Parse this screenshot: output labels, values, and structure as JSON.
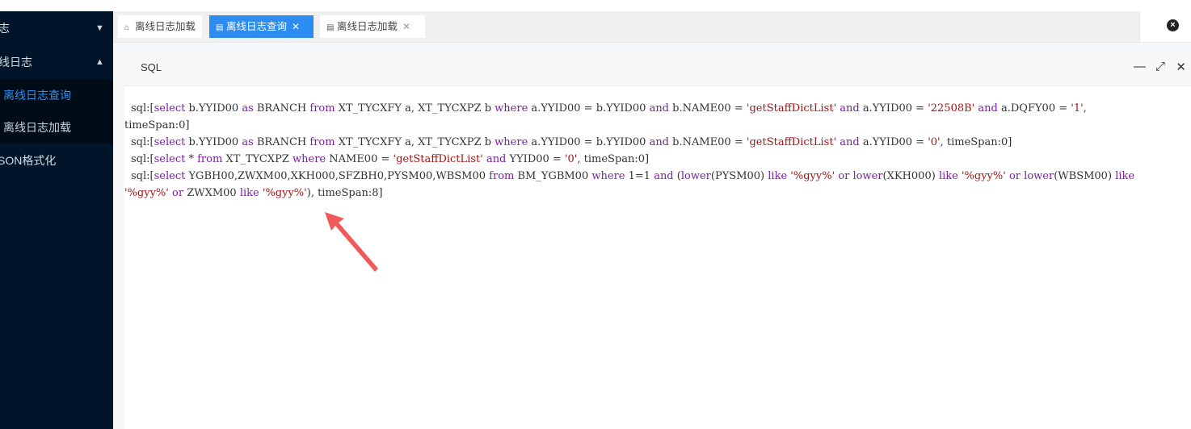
{
  "sidebar": {
    "group1": "志",
    "group2": "线日志",
    "items": [
      "离线日志查询",
      "离线日志加载"
    ],
    "group3": "SON格式化"
  },
  "tabs": [
    {
      "icon": "home-icon",
      "label": "离线日志加载",
      "closable": false
    },
    {
      "icon": "file-icon",
      "label": "离线日志查询",
      "closable": true,
      "active": true
    },
    {
      "icon": "file-icon",
      "label": "离线日志加载",
      "closable": true
    }
  ],
  "panel": {
    "title": "SQL"
  },
  "sql_lines": [
    [
      [
        "p",
        "sql:["
      ],
      [
        "k",
        "select"
      ],
      [
        "p",
        " b.YYID00 "
      ],
      [
        "k",
        "as"
      ],
      [
        "p",
        " BRANCH "
      ],
      [
        "k",
        "from"
      ],
      [
        "p",
        " XT_TYCXFY a, XT_TYCXPZ b "
      ],
      [
        "k",
        "where"
      ],
      [
        "p",
        " a.YYID00 = b.YYID00 "
      ],
      [
        "k",
        "and"
      ],
      [
        "p",
        " b.NAME00 = "
      ],
      [
        "s",
        "'getStaffDictList'"
      ],
      [
        "p",
        " "
      ],
      [
        "k",
        "and"
      ],
      [
        "p",
        " a.YYID00 = "
      ],
      [
        "s",
        "'22508B'"
      ],
      [
        "p",
        " "
      ],
      [
        "k",
        "and"
      ],
      [
        "p",
        " a.DQFY00 = "
      ],
      [
        "s",
        "'1'"
      ],
      [
        "p",
        ","
      ]
    ],
    [
      [
        "p",
        "timeSpan:0]"
      ]
    ],
    [
      [
        "p",
        "sql:["
      ],
      [
        "k",
        "select"
      ],
      [
        "p",
        " b.YYID00 "
      ],
      [
        "k",
        "as"
      ],
      [
        "p",
        " BRANCH "
      ],
      [
        "k",
        "from"
      ],
      [
        "p",
        " XT_TYCXFY a, XT_TYCXPZ b "
      ],
      [
        "k",
        "where"
      ],
      [
        "p",
        " a.YYID00 = b.YYID00 "
      ],
      [
        "k",
        "and"
      ],
      [
        "p",
        " b.NAME00 = "
      ],
      [
        "s",
        "'getStaffDictList'"
      ],
      [
        "p",
        " "
      ],
      [
        "k",
        "and"
      ],
      [
        "p",
        " a.YYID00 = "
      ],
      [
        "s",
        "'0'"
      ],
      [
        "p",
        ", timeSpan:0]"
      ]
    ],
    [
      [
        "p",
        "sql:["
      ],
      [
        "k",
        "select"
      ],
      [
        "p",
        " * "
      ],
      [
        "k",
        "from"
      ],
      [
        "p",
        " XT_TYCXPZ "
      ],
      [
        "k",
        "where"
      ],
      [
        "p",
        " NAME00 = "
      ],
      [
        "s",
        "'getStaffDictList'"
      ],
      [
        "p",
        " "
      ],
      [
        "k",
        "and"
      ],
      [
        "p",
        " YYID00 = "
      ],
      [
        "s",
        "'0'"
      ],
      [
        "p",
        ", timeSpan:0]"
      ]
    ],
    [
      [
        "p",
        "sql:["
      ],
      [
        "k",
        "select"
      ],
      [
        "p",
        " YGBH00,ZWXM00,XKH000,SFZBH0,PYSM00,WBSM00 "
      ],
      [
        "k",
        "from"
      ],
      [
        "p",
        " BM_YGBM00 "
      ],
      [
        "k",
        "where"
      ],
      [
        "p",
        " 1=1 "
      ],
      [
        "k",
        "and"
      ],
      [
        "p",
        " ("
      ],
      [
        "k",
        "lower"
      ],
      [
        "p",
        "(PYSM00) "
      ],
      [
        "k",
        "like"
      ],
      [
        "p",
        " "
      ],
      [
        "s",
        "'%gyy%'"
      ],
      [
        "p",
        " "
      ],
      [
        "k",
        "or"
      ],
      [
        "p",
        " "
      ],
      [
        "k",
        "lower"
      ],
      [
        "p",
        "(XKH000) "
      ],
      [
        "k",
        "like"
      ],
      [
        "p",
        " "
      ],
      [
        "s",
        "'%gyy%'"
      ],
      [
        "p",
        " "
      ],
      [
        "k",
        "or"
      ],
      [
        "p",
        " "
      ],
      [
        "k",
        "lower"
      ],
      [
        "p",
        "(WBSM00) "
      ],
      [
        "k",
        "like"
      ]
    ],
    [
      [
        "s",
        "'%gyy%'"
      ],
      [
        "p",
        " "
      ],
      [
        "k",
        "or"
      ],
      [
        "p",
        " ZWXM00 "
      ],
      [
        "k",
        "like"
      ],
      [
        "p",
        " "
      ],
      [
        "s",
        "'%gyy%'"
      ],
      [
        "p",
        "), timeSpan:8]"
      ]
    ]
  ]
}
